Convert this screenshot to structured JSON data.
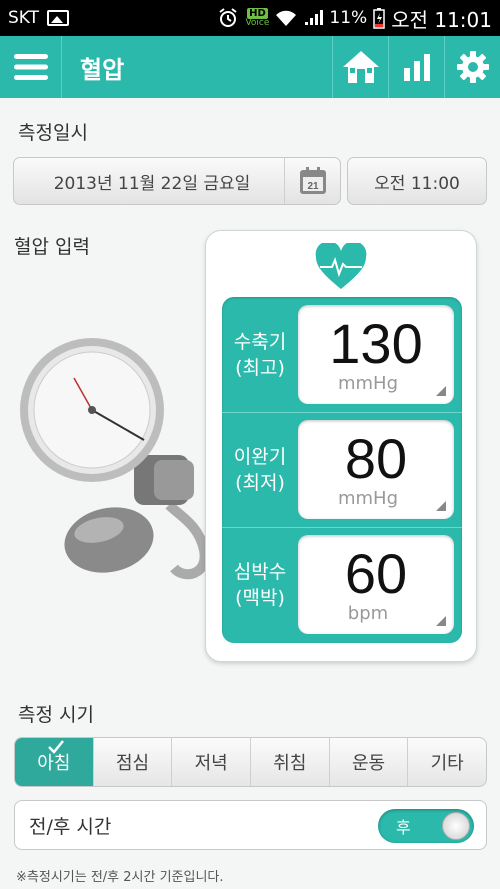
{
  "status": {
    "carrier": "SKT",
    "hd": "HD",
    "voice": "Voice",
    "battery": "11%",
    "time": "오전 11:01"
  },
  "header": {
    "title": "혈압"
  },
  "datetime": {
    "label": "측정일시",
    "date": "2013년 11월 22일 금요일",
    "calendar_day": "21",
    "time": "오전 11:00"
  },
  "bp": {
    "label": "혈압 입력",
    "rows": [
      {
        "label1": "수축기",
        "label2": "(최고)",
        "value": "130",
        "unit": "mmHg"
      },
      {
        "label1": "이완기",
        "label2": "(최저)",
        "value": "80",
        "unit": "mmHg"
      },
      {
        "label1": "심박수",
        "label2": "(맥박)",
        "value": "60",
        "unit": "bpm"
      }
    ]
  },
  "timing": {
    "label": "측정 시기",
    "tabs": [
      "아침",
      "점심",
      "저녁",
      "취침",
      "운동",
      "기타"
    ],
    "selected": "아침"
  },
  "before_after": {
    "label": "전/후 시간",
    "value": "후"
  },
  "note": "※측정시기는 전/후 2시간 기준입니다.",
  "colors": {
    "accent": "#2bb9ab",
    "active_tab": "#2fa99c"
  }
}
